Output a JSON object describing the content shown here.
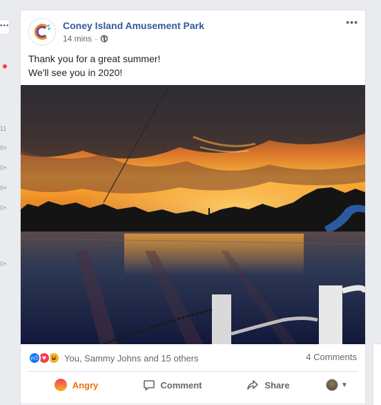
{
  "sidebar": {
    "more_dots": "•••",
    "counts": [
      "11",
      "0+",
      "0+",
      "0+",
      "0+",
      "0+"
    ]
  },
  "post": {
    "page_name": "Coney Island Amusement Park",
    "timestamp": "14 mins",
    "separator": "·",
    "text_line1": "Thank you for a great summer!",
    "text_line2": "We'll see you in 2020!",
    "more_dots": "•••",
    "reactions_text": "You, Sammy Johns and 15 others",
    "comments_count": "4 Comments",
    "reaction_icons": [
      "like-icon",
      "love-icon",
      "haha-icon"
    ]
  },
  "actions": {
    "angry": "Angry",
    "comment": "Comment",
    "share": "Share"
  },
  "colors": {
    "link": "#365899",
    "angry": "#e9710f",
    "like": "#1877f2",
    "love": "#f33e58",
    "haha": "#f7b125"
  }
}
